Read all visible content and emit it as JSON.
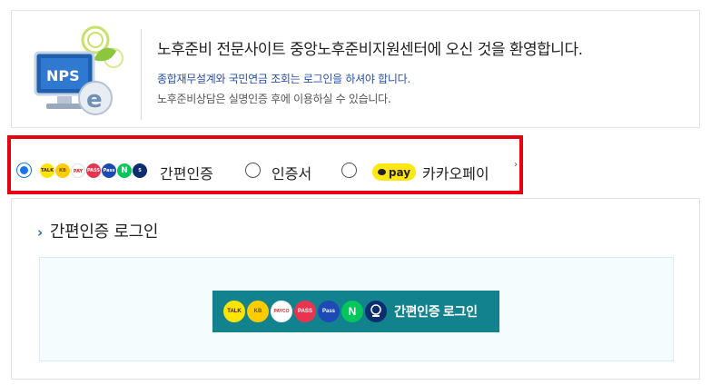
{
  "welcome": {
    "logo_text": "NPS",
    "title": "노후준비 전문사이트 중앙노후준비지원센터에 오신 것을 환영합니다.",
    "notice": "종합재무설계와 국민연금 조회는 로그인을 하셔야 합니다.",
    "sub": "노후준비상담은 실명인증 후에 이용하실 수 있습니다."
  },
  "methods": {
    "options": [
      {
        "label": "간편인증",
        "selected": true
      },
      {
        "label": "인증서",
        "selected": false
      },
      {
        "label": "카카오페이",
        "selected": false
      }
    ],
    "kakaopay_badge": "pay",
    "provider_icons": [
      "kakao-icon",
      "kb-icon",
      "payco-icon",
      "pass-icon",
      "samsung-pass-icon",
      "naver-icon",
      "shinhan-icon"
    ]
  },
  "panel": {
    "title": "간편인증 로그인",
    "login_button": "간편인증 로그인",
    "icon_texts": {
      "kakao": "TALK",
      "kb": "KB",
      "payco": "PAYCO",
      "pass": "PASS",
      "samsung": "Pass",
      "naver": "N"
    }
  },
  "colors": {
    "highlight_border": "#e60012",
    "radio_selected": "#1a73e8",
    "login_button_bg": "#13828f",
    "notice_text": "#2a4fa8"
  }
}
